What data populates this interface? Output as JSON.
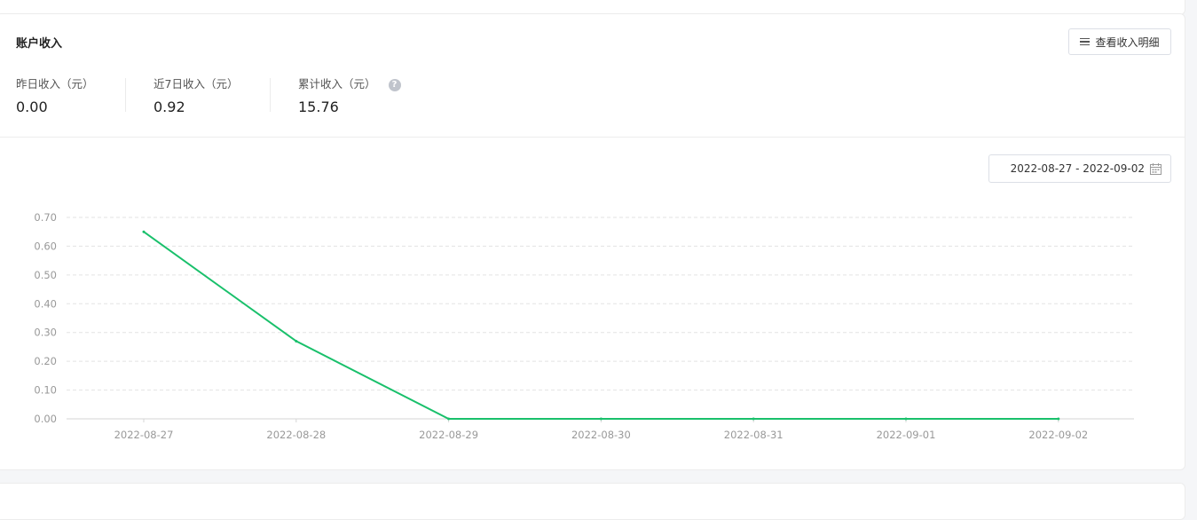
{
  "card": {
    "title": "账户收入",
    "detail_button": "查看收入明细"
  },
  "stats": [
    {
      "label": "昨日收入（元）",
      "value": "0.00"
    },
    {
      "label": "近7日收入（元）",
      "value": "0.92"
    },
    {
      "label": "累计收入（元）",
      "value": "15.76",
      "help_icon": "question-circle-icon"
    }
  ],
  "date_range": {
    "value": "2022-08-27 - 2022-09-02",
    "icon": "calendar-icon"
  },
  "colors": {
    "line": "#19c06b",
    "grid": "#e3e3e3",
    "axis_text": "#999999"
  },
  "chart_data": {
    "type": "line",
    "x": [
      "2022-08-27",
      "2022-08-28",
      "2022-08-29",
      "2022-08-30",
      "2022-08-31",
      "2022-09-01",
      "2022-09-02"
    ],
    "series": [
      {
        "values": [
          0.65,
          0.27,
          0.0,
          0.0,
          0.0,
          0.0,
          0.0
        ]
      }
    ],
    "yticks": [
      "0.00",
      "0.10",
      "0.20",
      "0.30",
      "0.40",
      "0.50",
      "0.60",
      "0.70"
    ],
    "ylim": [
      0,
      0.7
    ],
    "grid": "dashed horizontal",
    "legend": "none",
    "title": "",
    "xlabel": "",
    "ylabel": ""
  }
}
